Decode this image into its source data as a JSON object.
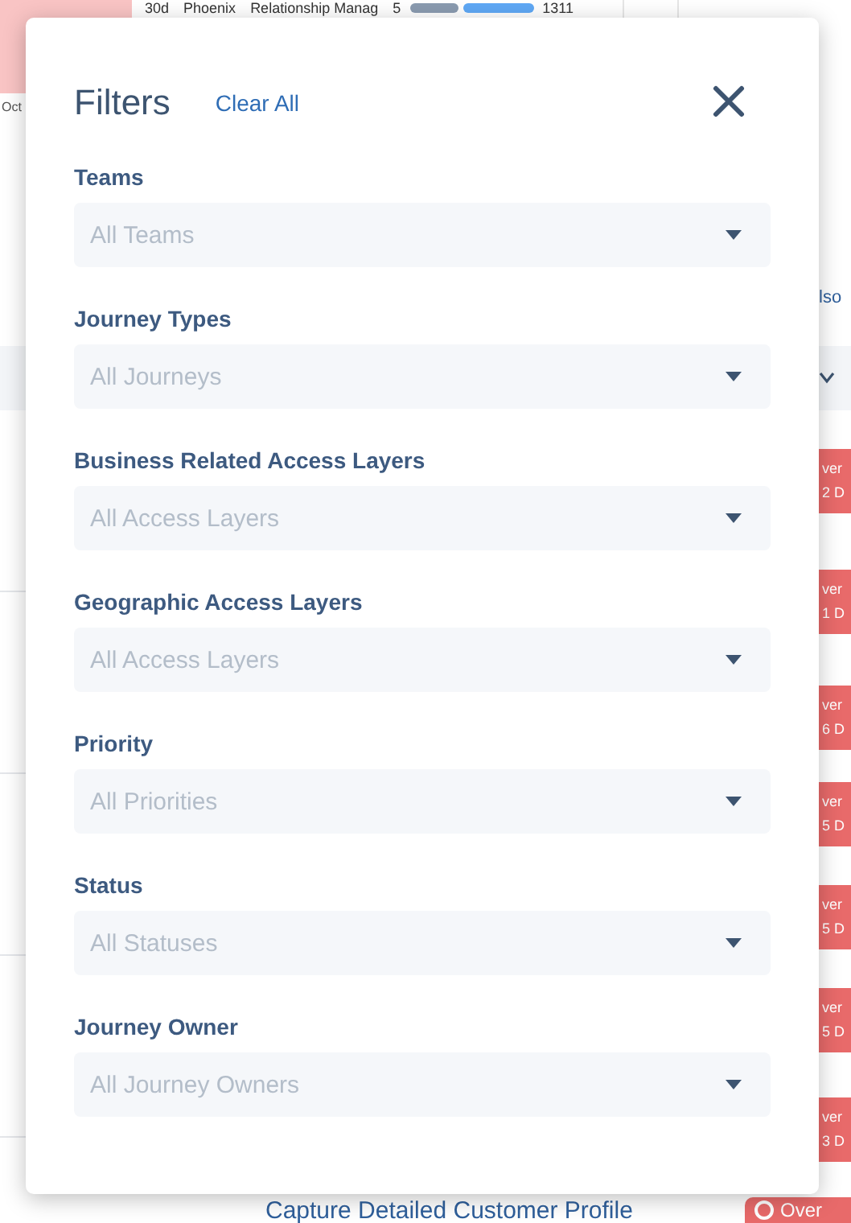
{
  "background": {
    "chart": {
      "labels": [
        {
          "text": "30d"
        },
        {
          "text": "Phoenix"
        },
        {
          "text": "Relationship Manag"
        },
        {
          "text": "5"
        }
      ],
      "bar_value": "1311",
      "axis_label": "Oct"
    },
    "side_heading": "lso",
    "badges": [
      {
        "line_1": "ver",
        "line_2": "2 D"
      },
      {
        "line_1": "ver",
        "line_2": "1 D"
      },
      {
        "line_1": "ver",
        "line_2": "6 D"
      },
      {
        "line_1": "ver",
        "line_2": "5 D"
      },
      {
        "line_1": "ver",
        "line_2": "5 D"
      },
      {
        "line_1": "ver",
        "line_2": "5 D"
      },
      {
        "line_1": "ver",
        "line_2": "3 D"
      }
    ],
    "link": "Capture Detailed Customer Profile",
    "bottom_badge": "Over"
  },
  "modal": {
    "title": "Filters",
    "clear_button": "Clear All",
    "filters": [
      {
        "label": "Teams",
        "placeholder": "All Teams"
      },
      {
        "label": "Journey Types",
        "placeholder": "All Journeys"
      },
      {
        "label": "Business Related Access Layers",
        "placeholder": "All Access Layers"
      },
      {
        "label": "Geographic Access Layers",
        "placeholder": "All Access Layers"
      },
      {
        "label": "Priority",
        "placeholder": "All Priorities"
      },
      {
        "label": "Status",
        "placeholder": "All Statuses"
      },
      {
        "label": "Journey Owner",
        "placeholder": "All Journey Owners"
      }
    ]
  }
}
